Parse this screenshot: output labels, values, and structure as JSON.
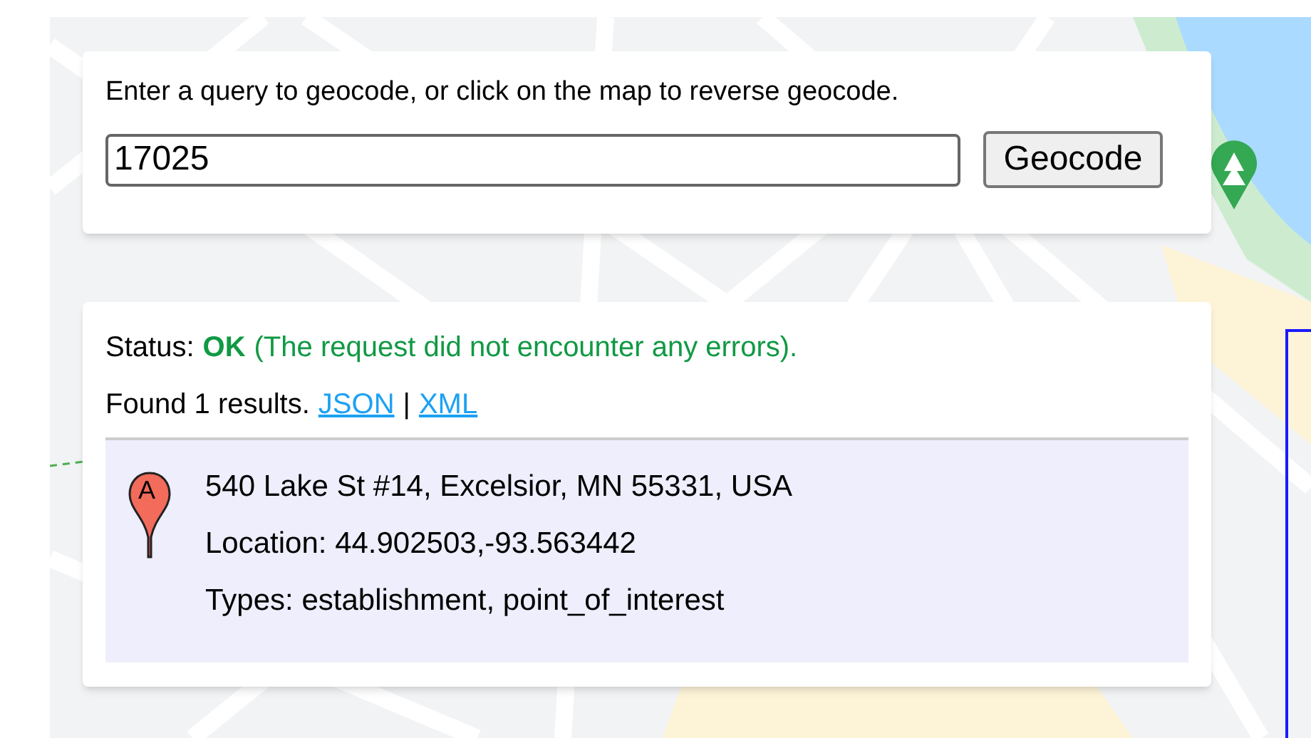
{
  "query_panel": {
    "instructions": "Enter a query to geocode, or click on the map to reverse geocode.",
    "query": "17025",
    "button": "Geocode"
  },
  "results_panel": {
    "status_label": "Status:",
    "status_code": "OK",
    "status_message": "(The request did not encounter any errors).",
    "found": "Found 1 results.",
    "links": [
      "JSON",
      "XML"
    ],
    "separator": "|",
    "results": [
      {
        "marker": "A",
        "address": "540 Lake St #14, Excelsior, MN 55331, USA",
        "location": "Location: 44.902503,-93.563442",
        "types": "Types: establishment, point_of_interest"
      }
    ]
  }
}
